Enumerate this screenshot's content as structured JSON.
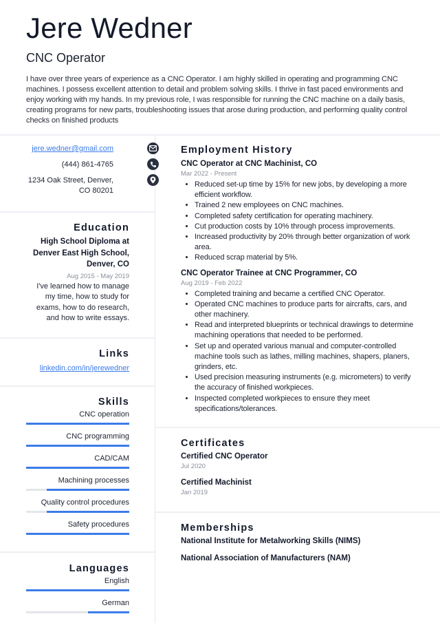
{
  "header": {
    "name": "Jere Wedner",
    "title": "CNC Operator",
    "summary": "I have over three years of experience as a CNC Operator. I am highly skilled in operating and programming CNC machines. I possess excellent attention to detail and problem solving skills. I thrive in fast paced environments and enjoy working with my hands. In my previous role, I was responsible for running the CNC machine on a daily basis, creating programs for new parts, troubleshooting issues that arose during production, and performing quality control checks on finished products"
  },
  "contact": {
    "email": "jere.wedner@gmail.com",
    "phone": "(444) 861-4765",
    "address": "1234 Oak Street, Denver, CO 80201",
    "icons": [
      "envelope-icon",
      "phone-icon",
      "map-pin-icon"
    ]
  },
  "education": {
    "heading": "Education",
    "degree": "High School Diploma at Denver East High School, Denver, CO",
    "dates": "Aug 2015 - May 2019",
    "description": "I've learned how to manage my time, how to study for exams, how to do research, and how to write essays."
  },
  "links": {
    "heading": "Links",
    "items": [
      "linkedin.com/in/jerewedner"
    ]
  },
  "skills": {
    "heading": "Skills",
    "items": [
      {
        "name": "CNC operation",
        "level": 1.0
      },
      {
        "name": "CNC programming",
        "level": 1.0
      },
      {
        "name": "CAD/CAM",
        "level": 1.0
      },
      {
        "name": "Machining processes",
        "level": 0.8
      },
      {
        "name": "Quality control procedures",
        "level": 0.8
      },
      {
        "name": "Safety procedures",
        "level": 1.0
      }
    ]
  },
  "languages": {
    "heading": "Languages",
    "items": [
      {
        "name": "English",
        "level": 1.0
      },
      {
        "name": "German",
        "level": 0.4
      }
    ]
  },
  "employment": {
    "heading": "Employment History",
    "jobs": [
      {
        "title": "CNC Operator at CNC Machinist, CO",
        "dates": "Mar 2022 - Present",
        "bullets": [
          "Reduced set-up time by 15% for new jobs, by developing a more efficient workflow.",
          "Trained 2 new employees on CNC machines.",
          "Completed safety certification for operating machinery.",
          "Cut production costs by 10% through process improvements.",
          "Increased productivity by 20% through better organization of work area.",
          "Reduced scrap material by 5%."
        ]
      },
      {
        "title": "CNC Operator Trainee at CNC Programmer, CO",
        "dates": "Aug 2019 - Feb 2022",
        "bullets": [
          "Completed training and became a certified CNC Operator.",
          "Operated CNC machines to produce parts for aircrafts, cars, and other machinery.",
          "Read and interpreted blueprints or technical drawings to determine machining operations that needed to be performed.",
          "Set up and operated various manual and computer-controlled machine tools such as lathes, milling machines, shapers, planers, grinders, etc.",
          "Used precision measuring instruments (e.g. micrometers) to verify the accuracy of finished workpieces.",
          "Inspected completed workpieces to ensure they meet specifications/tolerances."
        ]
      }
    ]
  },
  "certificates": {
    "heading": "Certificates",
    "items": [
      {
        "name": "Certified CNC Operator",
        "date": "Jul 2020"
      },
      {
        "name": "Certified Machinist",
        "date": "Jan 2019"
      }
    ]
  },
  "memberships": {
    "heading": "Memberships",
    "items": [
      "National Institute for Metalworking Skills (NIMS)",
      "National Association of Manufacturers (NAM)"
    ]
  },
  "colors": {
    "accent": "#3b7be8",
    "text": "#1c2230",
    "muted": "#8a8f99",
    "bar_track": "#e4e6ea",
    "icon_bg": "#2b3040"
  }
}
